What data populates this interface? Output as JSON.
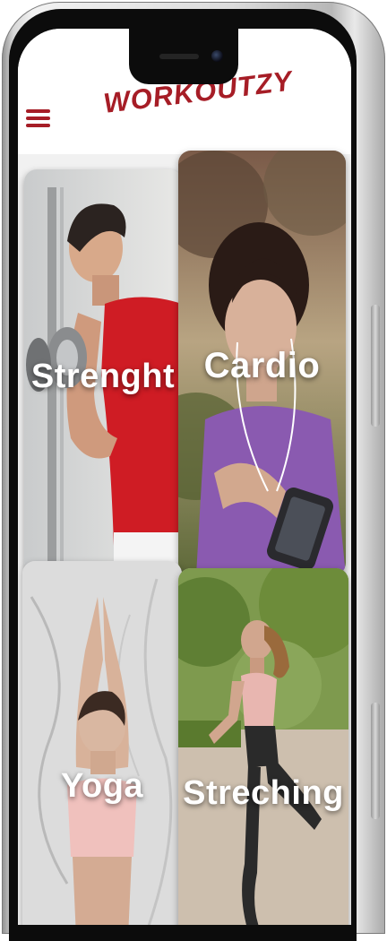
{
  "app": {
    "title": "WORKOUTZY",
    "menu_icon": "hamburger-menu-icon",
    "accent_color": "#a61d26"
  },
  "workouts": [
    {
      "label": "Strenght"
    },
    {
      "label": "Cardio"
    },
    {
      "label": "Yoga"
    },
    {
      "label": "Streching"
    }
  ]
}
